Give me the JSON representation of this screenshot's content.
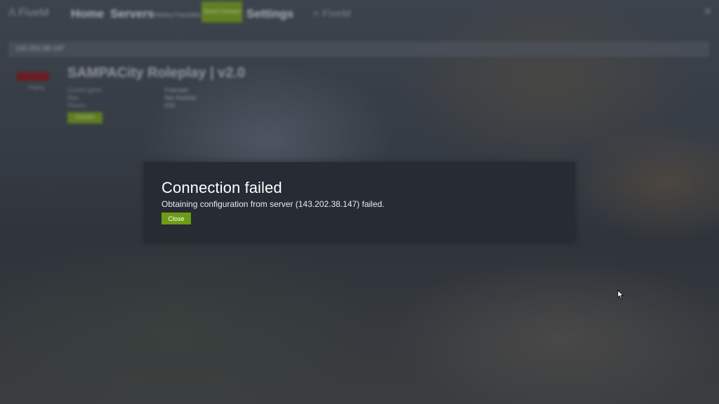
{
  "topnav": {
    "logo": "Λ FiveM",
    "home": "Home",
    "servers": "Servers",
    "small1": "History",
    "small2": "Favorites",
    "direct_connect": "Direct Connect",
    "settings": "Settings",
    "search": "< FiveM",
    "close": "✕"
  },
  "address_bar": {
    "value": "143.202.38.147"
  },
  "server": {
    "banner_sub": "Playing",
    "title": "SAMPACity Roleplay | v2.0",
    "rows": [
      {
        "label": "Current game",
        "value": "Freeroam"
      },
      {
        "label": "Map",
        "value": "San Andreas"
      },
      {
        "label": "Players",
        "value": "0/32"
      }
    ],
    "connect_label": "Connect"
  },
  "dialog": {
    "title": "Connection failed",
    "message": "Obtaining configuration from server (143.202.38.147) failed.",
    "close_label": "Close"
  },
  "colors": {
    "accent": "#6e9b16",
    "dialog_bg": "#272b34"
  }
}
